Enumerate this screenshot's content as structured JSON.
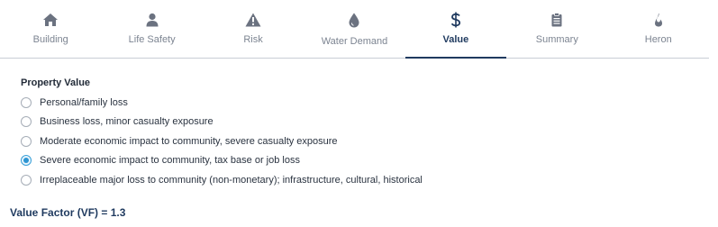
{
  "tabs": [
    {
      "label": "Building",
      "icon": "house-icon",
      "active": false
    },
    {
      "label": "Life Safety",
      "icon": "person-icon",
      "active": false
    },
    {
      "label": "Risk",
      "icon": "warning-icon",
      "active": false
    },
    {
      "label": "Water Demand",
      "icon": "water-drop-icon",
      "active": false
    },
    {
      "label": "Value",
      "icon": "dollar-icon",
      "active": true
    },
    {
      "label": "Summary",
      "icon": "clipboard-icon",
      "active": false
    },
    {
      "label": "Heron",
      "icon": "flame-icon",
      "active": false
    }
  ],
  "property_value": {
    "title": "Property Value",
    "options": [
      {
        "label": "Personal/family loss",
        "selected": false
      },
      {
        "label": "Business loss, minor casualty exposure",
        "selected": false
      },
      {
        "label": "Moderate economic impact to community, severe casualty exposure",
        "selected": false
      },
      {
        "label": "Severe economic impact to community, tax base or job loss",
        "selected": true
      },
      {
        "label": "Irreplaceable major loss to community (non-monetary); infrastructure, cultural, historical",
        "selected": false
      }
    ]
  },
  "value_factor": {
    "text": "Value Factor (VF) = 1.3"
  },
  "colors": {
    "active_tab": "#1f3a5f",
    "inactive_tab": "#7c8491",
    "icon": "#6b7280",
    "radio_selected": "#2d95d2"
  }
}
